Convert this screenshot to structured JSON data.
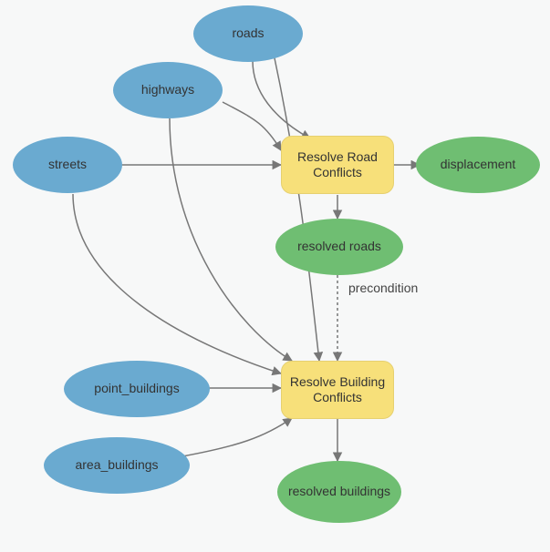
{
  "diagram": {
    "nodes": {
      "roads": "roads",
      "highways": "highways",
      "streets": "streets",
      "point_buildings": "point_buildings",
      "area_buildings": "area_buildings",
      "resolve_road": "Resolve Road Conflicts",
      "resolve_building": "Resolve Building Conflicts",
      "displacement": "displacement",
      "resolved_roads": "resolved roads",
      "resolved_buildings": "resolved buildings"
    },
    "edges": {
      "precondition": "precondition"
    }
  }
}
